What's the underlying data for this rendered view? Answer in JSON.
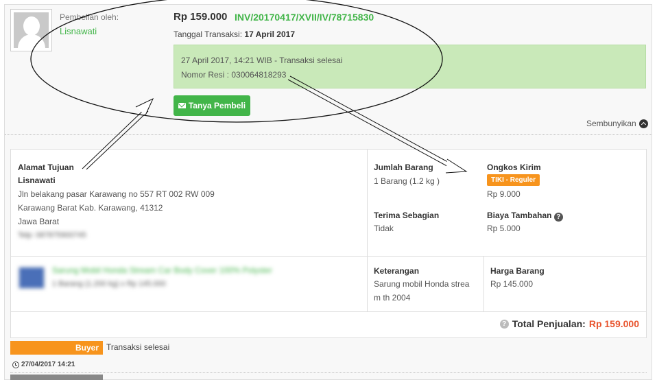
{
  "buyer": {
    "label": "Pembelian oleh:",
    "name": "Lisnawati"
  },
  "transaction": {
    "amount": "Rp 159.000",
    "invoice": "INV/20170417/XVII/IV/78715830",
    "date_label": "Tanggal Transaksi:",
    "date_value": "17 April 2017",
    "status_line": "27 April 2017, 14:21 WIB - Transaksi selesai",
    "resi_line": "Nomor Resi : 030064818293",
    "ask_button": "Tanya Pembeli",
    "hide_link": "Sembunyikan"
  },
  "address": {
    "title": "Alamat Tujuan",
    "name": "Lisnawati",
    "line1": "Jln belakang pasar Karawang no 557 RT 002 RW 009",
    "line2": "Karawang Barat Kab. Karawang, 41312",
    "line3": "Jawa Barat",
    "phone_blurred": "Telp: 087875900745"
  },
  "quantity": {
    "title": "Jumlah Barang",
    "value": "1 Barang (1.2 kg )"
  },
  "shipping": {
    "title": "Ongkos Kirim",
    "courier": "TIKI - Reguler",
    "value": "Rp 9.000"
  },
  "partial": {
    "title": "Terima Sebagian",
    "value": "Tidak"
  },
  "extra_cost": {
    "title": "Biaya Tambahan",
    "value": "Rp 5.000"
  },
  "product": {
    "name_blurred": "Sarung Mobil Honda Stream Car Body Cover 100% Polyster",
    "detail_blurred": "1 Barang (1.200 kg) x Rp 145.000"
  },
  "notes": {
    "title": "Keterangan",
    "line1": "Sarung mobil Honda strea",
    "line2": "m th 2004"
  },
  "item_price": {
    "title": "Harga Barang",
    "value": "Rp 145.000"
  },
  "total": {
    "label": "Total Penjualan:",
    "value": "Rp 159.000"
  },
  "history": {
    "tag": "Buyer",
    "status": "Transaksi selesai",
    "timestamp": "27/04/2017 14:21"
  },
  "colors": {
    "green": "#42b549",
    "orange": "#f7941d",
    "total_red": "#e8542e",
    "status_bg": "#c9e9b9"
  }
}
